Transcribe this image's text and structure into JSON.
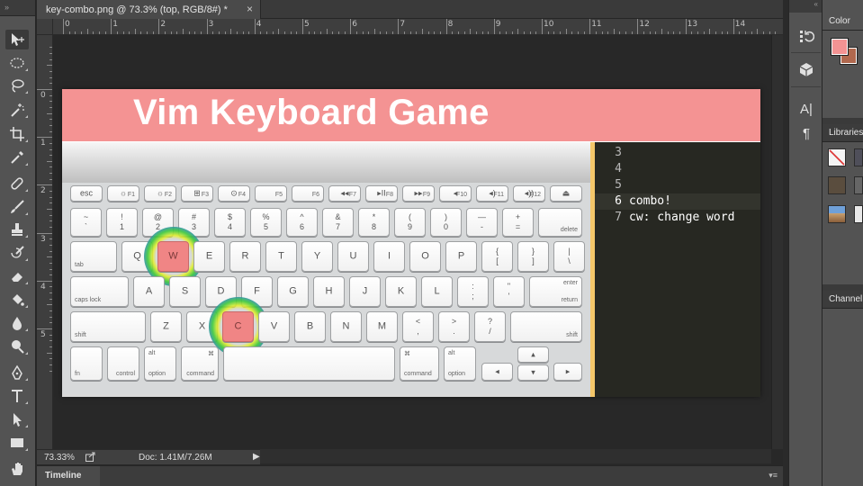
{
  "app": {
    "toolbar_grip": "»",
    "dock_grip": "«"
  },
  "document": {
    "tab_title": "key-combo.png @ 73.3% (top, RGB/8#) *",
    "close_glyph": "×"
  },
  "rulers": {
    "top_numbers": [
      "0",
      "1",
      "2",
      "3",
      "4",
      "5",
      "6",
      "7",
      "8",
      "9",
      "10",
      "11",
      "12",
      "13",
      "14"
    ],
    "left_numbers": [
      "0",
      "1",
      "2",
      "3",
      "4",
      "5"
    ]
  },
  "artboard": {
    "title": "Vim Keyboard Game",
    "editor": {
      "lines": [
        {
          "num": "3",
          "text": ""
        },
        {
          "num": "4",
          "text": ""
        },
        {
          "num": "5",
          "text": ""
        },
        {
          "num": "6",
          "text": "combo!",
          "current": true
        },
        {
          "num": "7",
          "text": "cw: change word"
        }
      ]
    },
    "keyboard": {
      "fn_row": [
        "esc",
        "☼",
        "☼",
        "⊞",
        "⊙",
        "",
        "",
        "◂◂",
        "▸II",
        "▸▸",
        "◂",
        "◂)",
        "◂))",
        "⏏"
      ],
      "fn_sub": [
        "",
        "F1",
        "F2",
        "F3",
        "F4",
        "F5",
        "F6",
        "F7",
        "F8",
        "F9",
        "F10",
        "F11",
        "F12",
        ""
      ],
      "num_row": [
        [
          "~",
          "`"
        ],
        [
          "!",
          "1"
        ],
        [
          "@",
          "2"
        ],
        [
          "#",
          "3"
        ],
        [
          "$",
          "4"
        ],
        [
          "%",
          "5"
        ],
        [
          "^",
          "6"
        ],
        [
          "&",
          "7"
        ],
        [
          "*",
          "8"
        ],
        [
          "(",
          "9"
        ],
        [
          ")",
          "0"
        ],
        [
          "—",
          "-"
        ],
        [
          "+",
          "="
        ]
      ],
      "delete_label": "delete",
      "tab_label": "tab",
      "q_row": [
        "Q",
        "W",
        "E",
        "R",
        "T",
        "Y",
        "U",
        "I",
        "O",
        "P"
      ],
      "q_row_sym": [
        [
          "{",
          "["
        ],
        [
          "}",
          "]"
        ],
        [
          "|",
          "\\"
        ]
      ],
      "caps_label": "caps lock",
      "a_row": [
        "A",
        "S",
        "D",
        "F",
        "G",
        "H",
        "J",
        "K",
        "L"
      ],
      "a_row_sym": [
        [
          ":",
          ";"
        ],
        [
          "\"",
          "'"
        ]
      ],
      "return_top": "enter",
      "return_label": "return",
      "shift_label": "shift",
      "z_row": [
        "Z",
        "X",
        "C",
        "V",
        "B",
        "N",
        "M"
      ],
      "z_row_sym": [
        [
          "<",
          ","
        ],
        [
          ">",
          "."
        ],
        [
          "?",
          "/"
        ]
      ],
      "fn_label": "fn",
      "control_label": "control",
      "alt_symbol": "alt",
      "option_label": "option",
      "command_symbol": "⌘",
      "command_label": "command",
      "arrows": {
        "left": "◂",
        "up": "▴",
        "down": "▾",
        "right": "▸"
      },
      "highlighted_keys": [
        "W",
        "C"
      ]
    }
  },
  "status": {
    "zoom": "73.33%",
    "doc_info": "Doc: 1.41M/7.26M",
    "arrow": "▶"
  },
  "timeline": {
    "tab_label": "Timeline"
  },
  "panels": {
    "color_tab": "Color",
    "libraries_tab": "Libraries",
    "channels_tab": "Channel",
    "foreground_color": "#f49393",
    "background_color": "#b0684e"
  },
  "dock": {
    "icons": [
      "history-icon",
      "3d-cube-icon",
      "character-icon",
      "paragraph-icon"
    ],
    "character_glyph": "A|",
    "paragraph_glyph": "¶"
  },
  "colors": {
    "banner": "#f49393",
    "divider": "#f5c76a",
    "editor_bg": "#272822",
    "highlight_key": "#f08585"
  }
}
